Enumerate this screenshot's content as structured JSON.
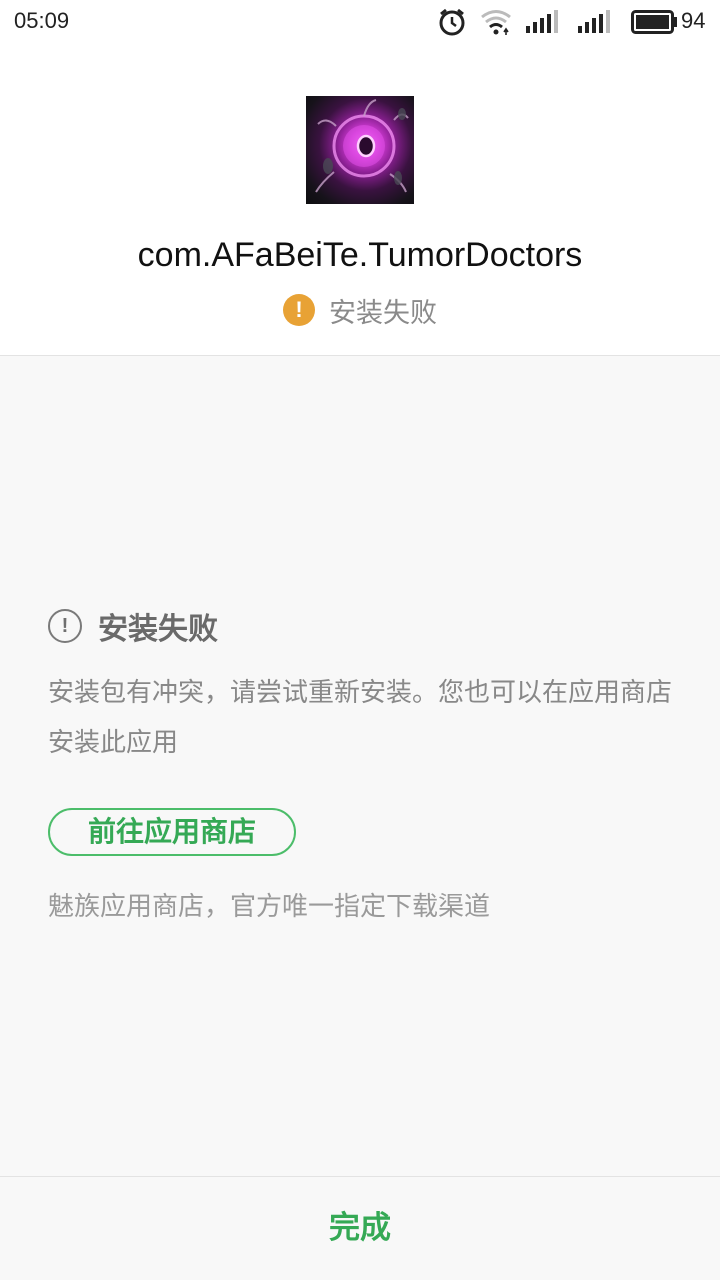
{
  "status_bar": {
    "time": "05:09",
    "battery": "94",
    "icons": [
      "alarm-icon",
      "wifi-icon",
      "signal-icon",
      "signal-icon",
      "battery-icon"
    ]
  },
  "app": {
    "name": "com.AFaBeiTe.TumorDoctors",
    "install_status": "安装失败",
    "icon": "app-icon"
  },
  "error": {
    "title": "安装失败",
    "description": "安装包有冲突，请尝试重新安装。您也可以在应用商店安装此应用"
  },
  "store": {
    "button_label": "前往应用商店",
    "note": "魅族应用商店，官方唯一指定下载渠道"
  },
  "footer": {
    "done_label": "完成"
  },
  "colors": {
    "accent_green": "#35a955",
    "warning_orange": "#e8a235"
  }
}
